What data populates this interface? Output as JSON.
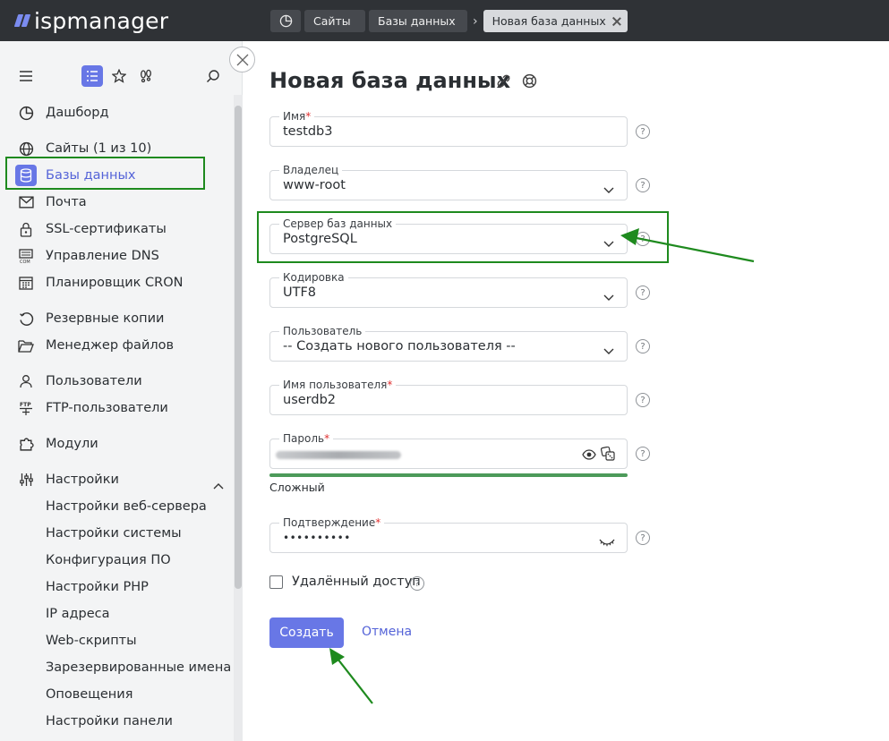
{
  "brand": {
    "name": "ispmanager"
  },
  "breadcrumbs": {
    "home_icon": "dashboard-icon",
    "items": [
      "Сайты",
      "Базы данных"
    ],
    "active": "Новая база данных"
  },
  "sidebar": {
    "items": [
      {
        "label": "Дашборд",
        "icon": "dashboard-icon"
      },
      {
        "label": "Сайты (1 из 10)",
        "icon": "globe-icon"
      },
      {
        "label": "Базы данных",
        "icon": "database-icon"
      },
      {
        "label": "Почта",
        "icon": "mail-icon"
      },
      {
        "label": "SSL-сертификаты",
        "icon": "lock-icon"
      },
      {
        "label": "Управление DNS",
        "icon": "dns-icon"
      },
      {
        "label": "Планировщик CRON",
        "icon": "calendar-icon"
      },
      {
        "label": "Резервные копии",
        "icon": "backup-icon"
      },
      {
        "label": "Менеджер файлов",
        "icon": "folder-icon"
      },
      {
        "label": "Пользователи",
        "icon": "user-icon"
      },
      {
        "label": "FTP-пользователи",
        "icon": "ftp-icon"
      },
      {
        "label": "Модули",
        "icon": "puzzle-icon"
      },
      {
        "label": "Настройки",
        "icon": "sliders-icon"
      }
    ],
    "settings_sub": [
      "Настройки веб-сервера",
      "Настройки системы",
      "Конфигурация ПО",
      "Настройки PHP",
      "IP адреса",
      "Web-скрипты",
      "Зарезервированные имена",
      "Оповещения",
      "Настройки панели"
    ]
  },
  "page": {
    "title": "Новая база данных"
  },
  "form": {
    "name": {
      "label": "Имя",
      "value": "testdb3"
    },
    "owner": {
      "label": "Владелец",
      "value": "www-root"
    },
    "server": {
      "label": "Сервер баз данных",
      "value": "PostgreSQL"
    },
    "encoding": {
      "label": "Кодировка",
      "value": "UTF8"
    },
    "user": {
      "label": "Пользователь",
      "value": "-- Создать нового пользователя --"
    },
    "username": {
      "label": "Имя пользователя",
      "value": "userdb2"
    },
    "password": {
      "label": "Пароль",
      "strength": "Сложный"
    },
    "confirm": {
      "label": "Подтверждение",
      "value": "••••••••••"
    },
    "remote_access": {
      "label": "Удалённый доступ",
      "checked": false
    },
    "required_mark": "*",
    "help_mark": "?"
  },
  "actions": {
    "create": "Создать",
    "cancel": "Отмена"
  },
  "colors": {
    "accent": "#6877e6",
    "topbar": "#2f3236",
    "annotation": "#1e8a1e",
    "strength": "#4c9a5a"
  }
}
